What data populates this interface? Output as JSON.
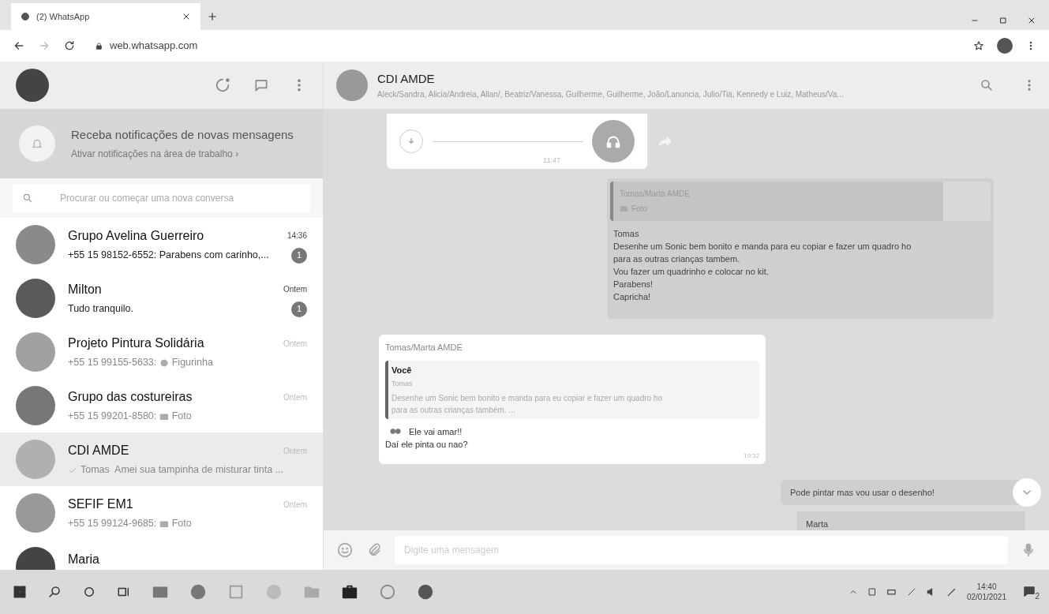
{
  "browser": {
    "tab_title": "(2) WhatsApp",
    "url": "web.whatsapp.com"
  },
  "notification_banner": {
    "title": "Receba notificações de novas mensagens",
    "link": "Ativar notificações na área de trabalho ›"
  },
  "search": {
    "placeholder": "Procurar ou começar uma nova conversa"
  },
  "chats": [
    {
      "name": "Grupo Avelina Guerreiro",
      "time": "14:36",
      "sender": "+55 15 98152-6552: ",
      "kind": "text",
      "preview": "Parabens com carinho,...",
      "unread": "1",
      "selected": false
    },
    {
      "name": "Milton",
      "time": "Ontem",
      "kind": "text",
      "preview": "Tudo tranquilo.",
      "unread": "1",
      "selected": false
    },
    {
      "name": "Projeto Pintura Solidária",
      "time": "Ontem",
      "sender": "+55 15 99155-5633: ",
      "kind": "sticker",
      "preview": "Figurinha",
      "selected": false
    },
    {
      "name": "Grupo das costureiras",
      "time": "Ontem",
      "sender": "+55 15 99201-8580: ",
      "kind": "photo",
      "preview": "Foto",
      "selected": false
    },
    {
      "name": "CDI AMDE",
      "time": "Ontem",
      "kind": "sent",
      "preview": "Tomas  Amei sua tampinha de misturar tinta ...",
      "selected": true
    },
    {
      "name": "SEFIF EM1",
      "time": "Ontem",
      "sender": "+55 15 99124-9685: ",
      "kind": "photo",
      "preview": "Foto",
      "selected": false
    },
    {
      "name": "Maria",
      "selected": false
    }
  ],
  "conversation": {
    "title": "CDI AMDE",
    "members": "Aleck/Sandra, Alicia/Andreia, Allan/, Beatriz/Vanessa, Guilherme, Guilherme, João/Lanuncia, Julio/Tia, Kennedy e  Luiz, Matheus/Va...",
    "messages": [
      {
        "kind": "voice",
        "time": "11:47"
      },
      {
        "kind": "quoted_photo",
        "quote_author": "Tomas/Marta AMDE",
        "quote_text": "Foto",
        "lines": [
          "Tomas",
          "Desenhe um Sonic bem bonito e manda para eu copiar e fazer um quadro ho",
          "para as outras crianças tambem.",
          "Vou fazer um quadrinho e colocar no kit.",
          "Parabens!",
          "Capricha!"
        ]
      },
      {
        "kind": "reply",
        "author": "Tomas/Marta AMDE",
        "quote_author": "Você",
        "quote_text": "Tomas",
        "quote_lines": [
          "Desenhe um Sonic bem bonito e manda para eu copiar e fazer um quadro ho",
          "para as outras crianças também. ..."
        ],
        "lines": [
          "Ele vai amar!!",
          "Daí ele pinta ou nao?"
        ],
        "time": "19:32"
      },
      {
        "kind": "text",
        "lines": [
          "Pode pintar mas vou usar o desenho!"
        ]
      },
      {
        "kind": "quote_cut",
        "quote_author": "Marta"
      }
    ],
    "composer_placeholder": "Digite uma mensagem"
  },
  "taskbar": {
    "time": "14:40",
    "date": "02/01/2021",
    "notifications": "2"
  }
}
